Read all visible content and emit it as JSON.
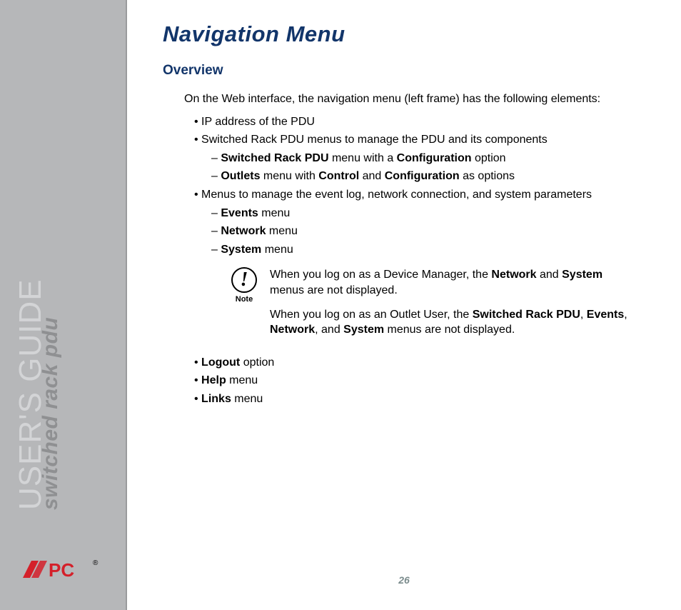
{
  "sidebar": {
    "title": "USER'S GUIDE",
    "subtitle": "switched rack pdu"
  },
  "logo": {
    "brand": "APC"
  },
  "page_number": "26",
  "heading": "Navigation Menu",
  "section": "Overview",
  "intro": "On the Web interface, the navigation menu (left frame) has the following elements:",
  "bullets": {
    "b0": "IP address of the PDU",
    "b1": "Switched Rack PDU menus to manage the PDU and its components",
    "b1s0_pre": "Switched Rack PDU",
    "b1s0_mid": " menu with a ",
    "b1s0_bold2": "Configuration",
    "b1s0_post": " option",
    "b1s1_b1": "Outlets",
    "b1s1_t1": " menu with ",
    "b1s1_b2": "Control",
    "b1s1_t2": " and ",
    "b1s1_b3": "Configuration",
    "b1s1_t3": " as options",
    "b2": "Menus to manage the event log, network connection, and system parameters",
    "b2s0_b": "Events",
    "b2s0_t": " menu",
    "b2s1_b": "Network",
    "b2s1_t": " menu",
    "b2s2_b": "System",
    "b2s2_t": " menu",
    "b3_b": "Logout",
    "b3_t": " option",
    "b4_b": "Help",
    "b4_t": " menu",
    "b5_b": "Links",
    "b5_t": " menu"
  },
  "note": {
    "icon_glyph": "!",
    "icon_label": "Note",
    "p1_t1": "When you log on as a Device Manager, the ",
    "p1_b1": "Network",
    "p1_t2": " and ",
    "p1_b2": "System",
    "p1_t3": " menus are not displayed.",
    "p2_t1": "When you log on as an Outlet User, the ",
    "p2_b1": "Switched Rack PDU",
    "p2_t2": ", ",
    "p2_b2": "Events",
    "p2_t3": ", ",
    "p2_b3": "Network",
    "p2_t4": ", and ",
    "p2_b4": "System",
    "p2_t5": " menus are not displayed."
  }
}
